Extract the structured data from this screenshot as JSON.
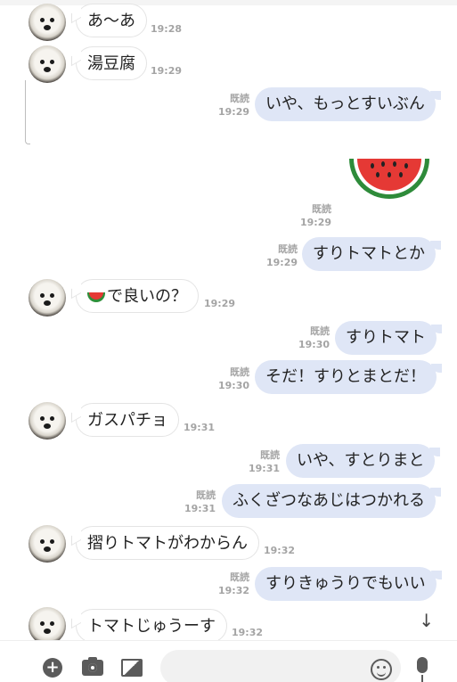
{
  "messages": [
    {
      "side": "in",
      "text": "あ〜あ",
      "time": "19:28"
    },
    {
      "side": "in",
      "text": "湯豆腐",
      "time": "19:29"
    },
    {
      "side": "out",
      "text": "いや、もっとすいぶん",
      "read": "既読",
      "time": "19:29"
    },
    {
      "side": "out",
      "sticker": "watermelon-sticker",
      "read": "既読",
      "time": "19:29"
    },
    {
      "side": "out",
      "text": "すりトマトとか",
      "read": "既読",
      "time": "19:29"
    },
    {
      "side": "in",
      "emoji": "watermelon-icon",
      "text": "で良いの？",
      "time": "19:29"
    },
    {
      "side": "out",
      "text": "すりトマト",
      "read": "既読",
      "time": "19:30"
    },
    {
      "side": "out",
      "text": "そだ！すりとまとだ！",
      "read": "既読",
      "time": "19:30"
    },
    {
      "side": "in",
      "text": "ガスパチョ",
      "time": "19:31"
    },
    {
      "side": "out",
      "text": "いや、すとりまと",
      "read": "既読",
      "time": "19:31"
    },
    {
      "side": "out",
      "text": "ふくざつなあじはつかれる",
      "read": "既読",
      "time": "19:31"
    },
    {
      "side": "in",
      "text": "摺りトマトがわからん",
      "time": "19:32"
    },
    {
      "side": "out",
      "text": "すりきゅうりでもいい",
      "read": "既読",
      "time": "19:32"
    },
    {
      "side": "in",
      "text": "トマトじゅうーす",
      "time": "19:32"
    }
  ],
  "composer": {
    "placeholder": "",
    "icons": [
      "plus-icon",
      "camera-icon",
      "image-icon",
      "emoji-icon",
      "mic-icon"
    ]
  },
  "scroll_down_glyph": "↓",
  "colors": {
    "outgoing_bubble": "#dfe6f6",
    "incoming_bubble": "#ffffff",
    "meta": "#a4a4a4"
  }
}
